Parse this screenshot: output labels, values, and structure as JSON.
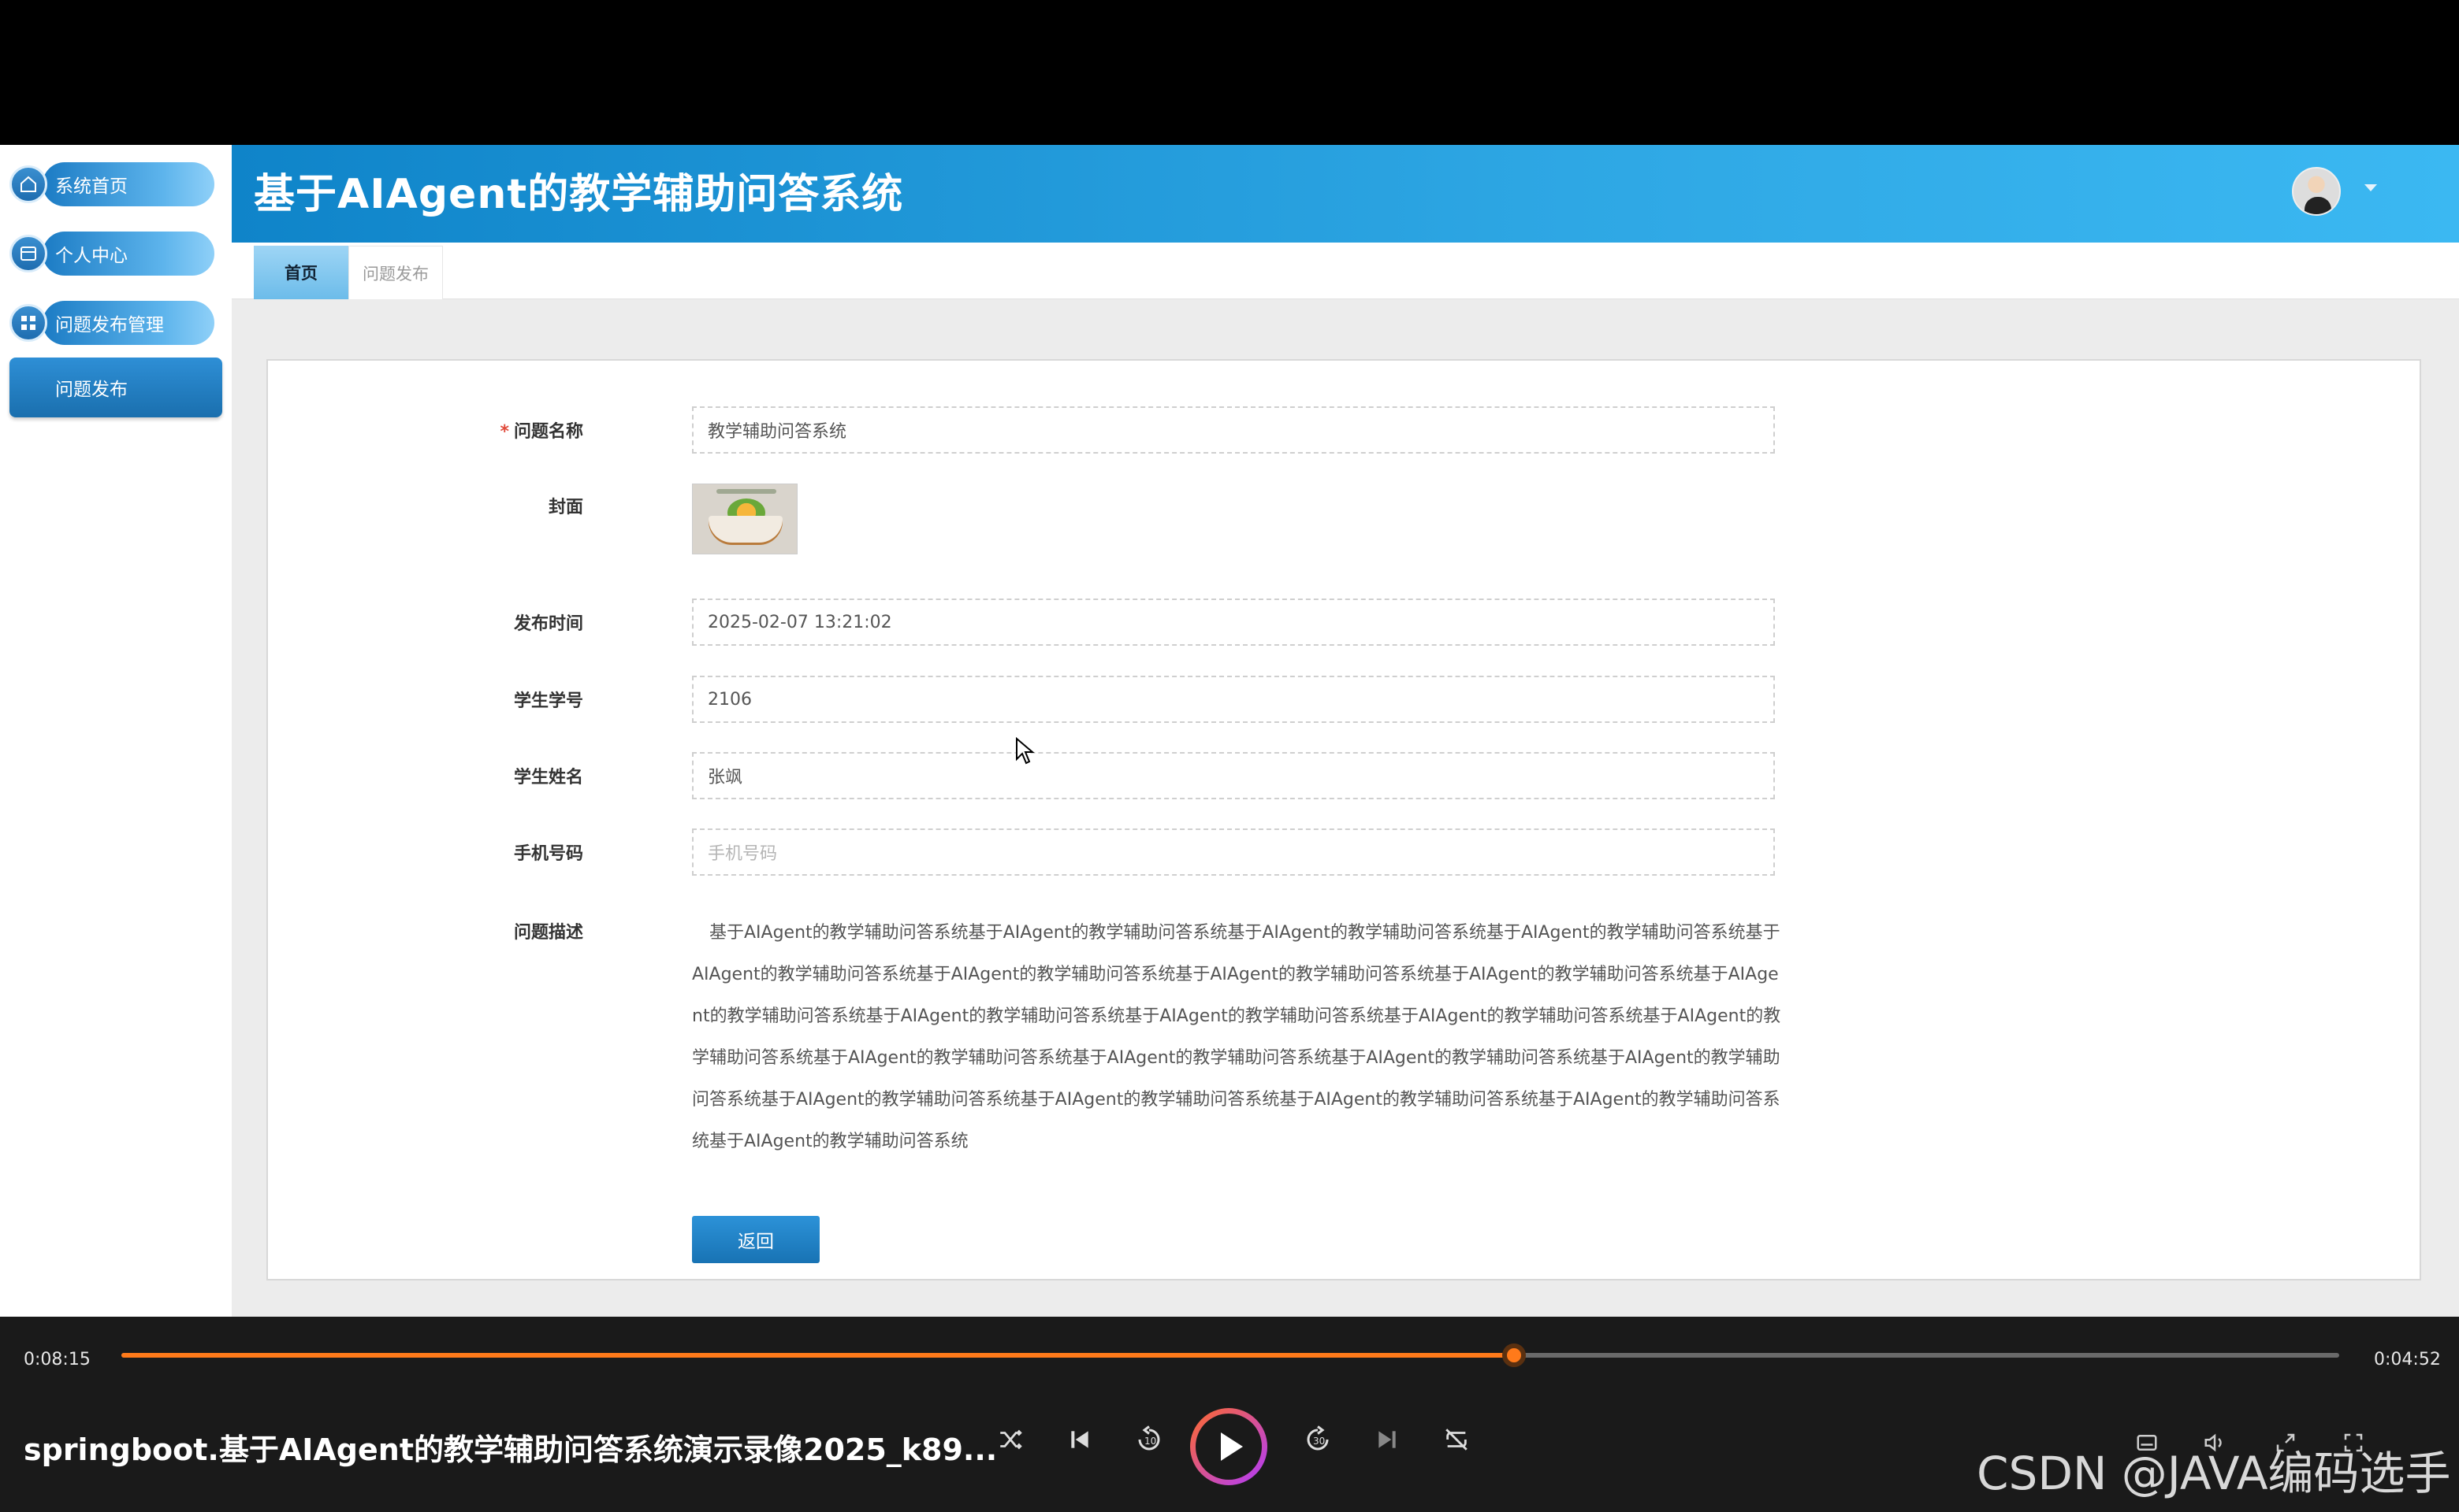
{
  "app": {
    "title": "基于AIAgent的教学辅助问答系统"
  },
  "sidebar": {
    "items": [
      {
        "label": "系统首页",
        "icon": "home-icon"
      },
      {
        "label": "个人中心",
        "icon": "card-icon"
      },
      {
        "label": "问题发布管理",
        "icon": "grid-icon"
      }
    ],
    "sub_item": {
      "label": "问题发布"
    }
  },
  "tabs": [
    {
      "label": "首页",
      "active": true
    },
    {
      "label": "问题发布",
      "active": false
    }
  ],
  "form": {
    "question_name": {
      "label": "问题名称",
      "required_mark": "*",
      "value": "教学辅助问答系统"
    },
    "cover": {
      "label": "封面"
    },
    "publish_time": {
      "label": "发布时间",
      "value": "2025-02-07 13:21:02"
    },
    "student_id": {
      "label": "学生学号",
      "value": "2106"
    },
    "student_name": {
      "label": "学生姓名",
      "value": "张飒"
    },
    "phone": {
      "label": "手机号码",
      "placeholder": "手机号码"
    },
    "description": {
      "label": "问题描述",
      "value": "基于AIAgent的教学辅助问答系统基于AIAgent的教学辅助问答系统基于AIAgent的教学辅助问答系统基于AIAgent的教学辅助问答系统基于AIAgent的教学辅助问答系统基于AIAgent的教学辅助问答系统基于AIAgent的教学辅助问答系统基于AIAgent的教学辅助问答系统基于AIAgent的教学辅助问答系统基于AIAgent的教学辅助问答系统基于AIAgent的教学辅助问答系统基于AIAgent的教学辅助问答系统基于AIAgent的教学辅助问答系统基于AIAgent的教学辅助问答系统基于AIAgent的教学辅助问答系统基于AIAgent的教学辅助问答系统基于AIAgent的教学辅助问答系统基于AIAgent的教学辅助问答系统基于AIAgent的教学辅助问答系统基于AIAgent的教学辅助问答系统基于AIAgent的教学辅助问答系统基于AIAgent的教学辅助问答系统"
    },
    "back_button": "返回"
  },
  "player": {
    "current_time": "0:08:15",
    "total_time": "0:04:52",
    "progress": 0.628,
    "video_title": "springboot.基于AIAgent的教学辅助问答系统演示录像2025_k89...",
    "watermark": "CSDN @JAVA编码选手",
    "accent_color": "#ff7a1a"
  }
}
